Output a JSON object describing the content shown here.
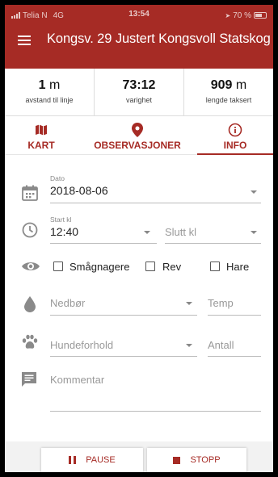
{
  "status_bar": {
    "carrier": "Telia N",
    "network": "4G",
    "time": "13:54",
    "battery": "70 %"
  },
  "header": {
    "title": "Kongsv. 29 Justert Kongsvoll Statskog"
  },
  "stats": [
    {
      "value": "1",
      "unit": "m",
      "label": "avstand til linje"
    },
    {
      "value": "73:12",
      "unit": "",
      "label": "varighet"
    },
    {
      "value": "909",
      "unit": "m",
      "label": "lengde taksert"
    }
  ],
  "tabs": {
    "map": "KART",
    "observations": "OBSERVASJONER",
    "info": "INFO"
  },
  "form": {
    "date_label": "Dato",
    "date_value": "2018-08-06",
    "start_label": "Start kl",
    "start_value": "12:40",
    "end_placeholder": "Slutt kl",
    "checkboxes": [
      "Smågnagere",
      "Rev",
      "Hare"
    ],
    "precip_placeholder": "Nedbør",
    "temp_placeholder": "Temp",
    "dog_placeholder": "Hundeforhold",
    "count_placeholder": "Antall",
    "comment_placeholder": "Kommentar"
  },
  "buttons": {
    "pause": "PAUSE",
    "stop": "STOPP"
  },
  "colors": {
    "primary": "#a62b25",
    "icon": "#8a8a8a"
  }
}
